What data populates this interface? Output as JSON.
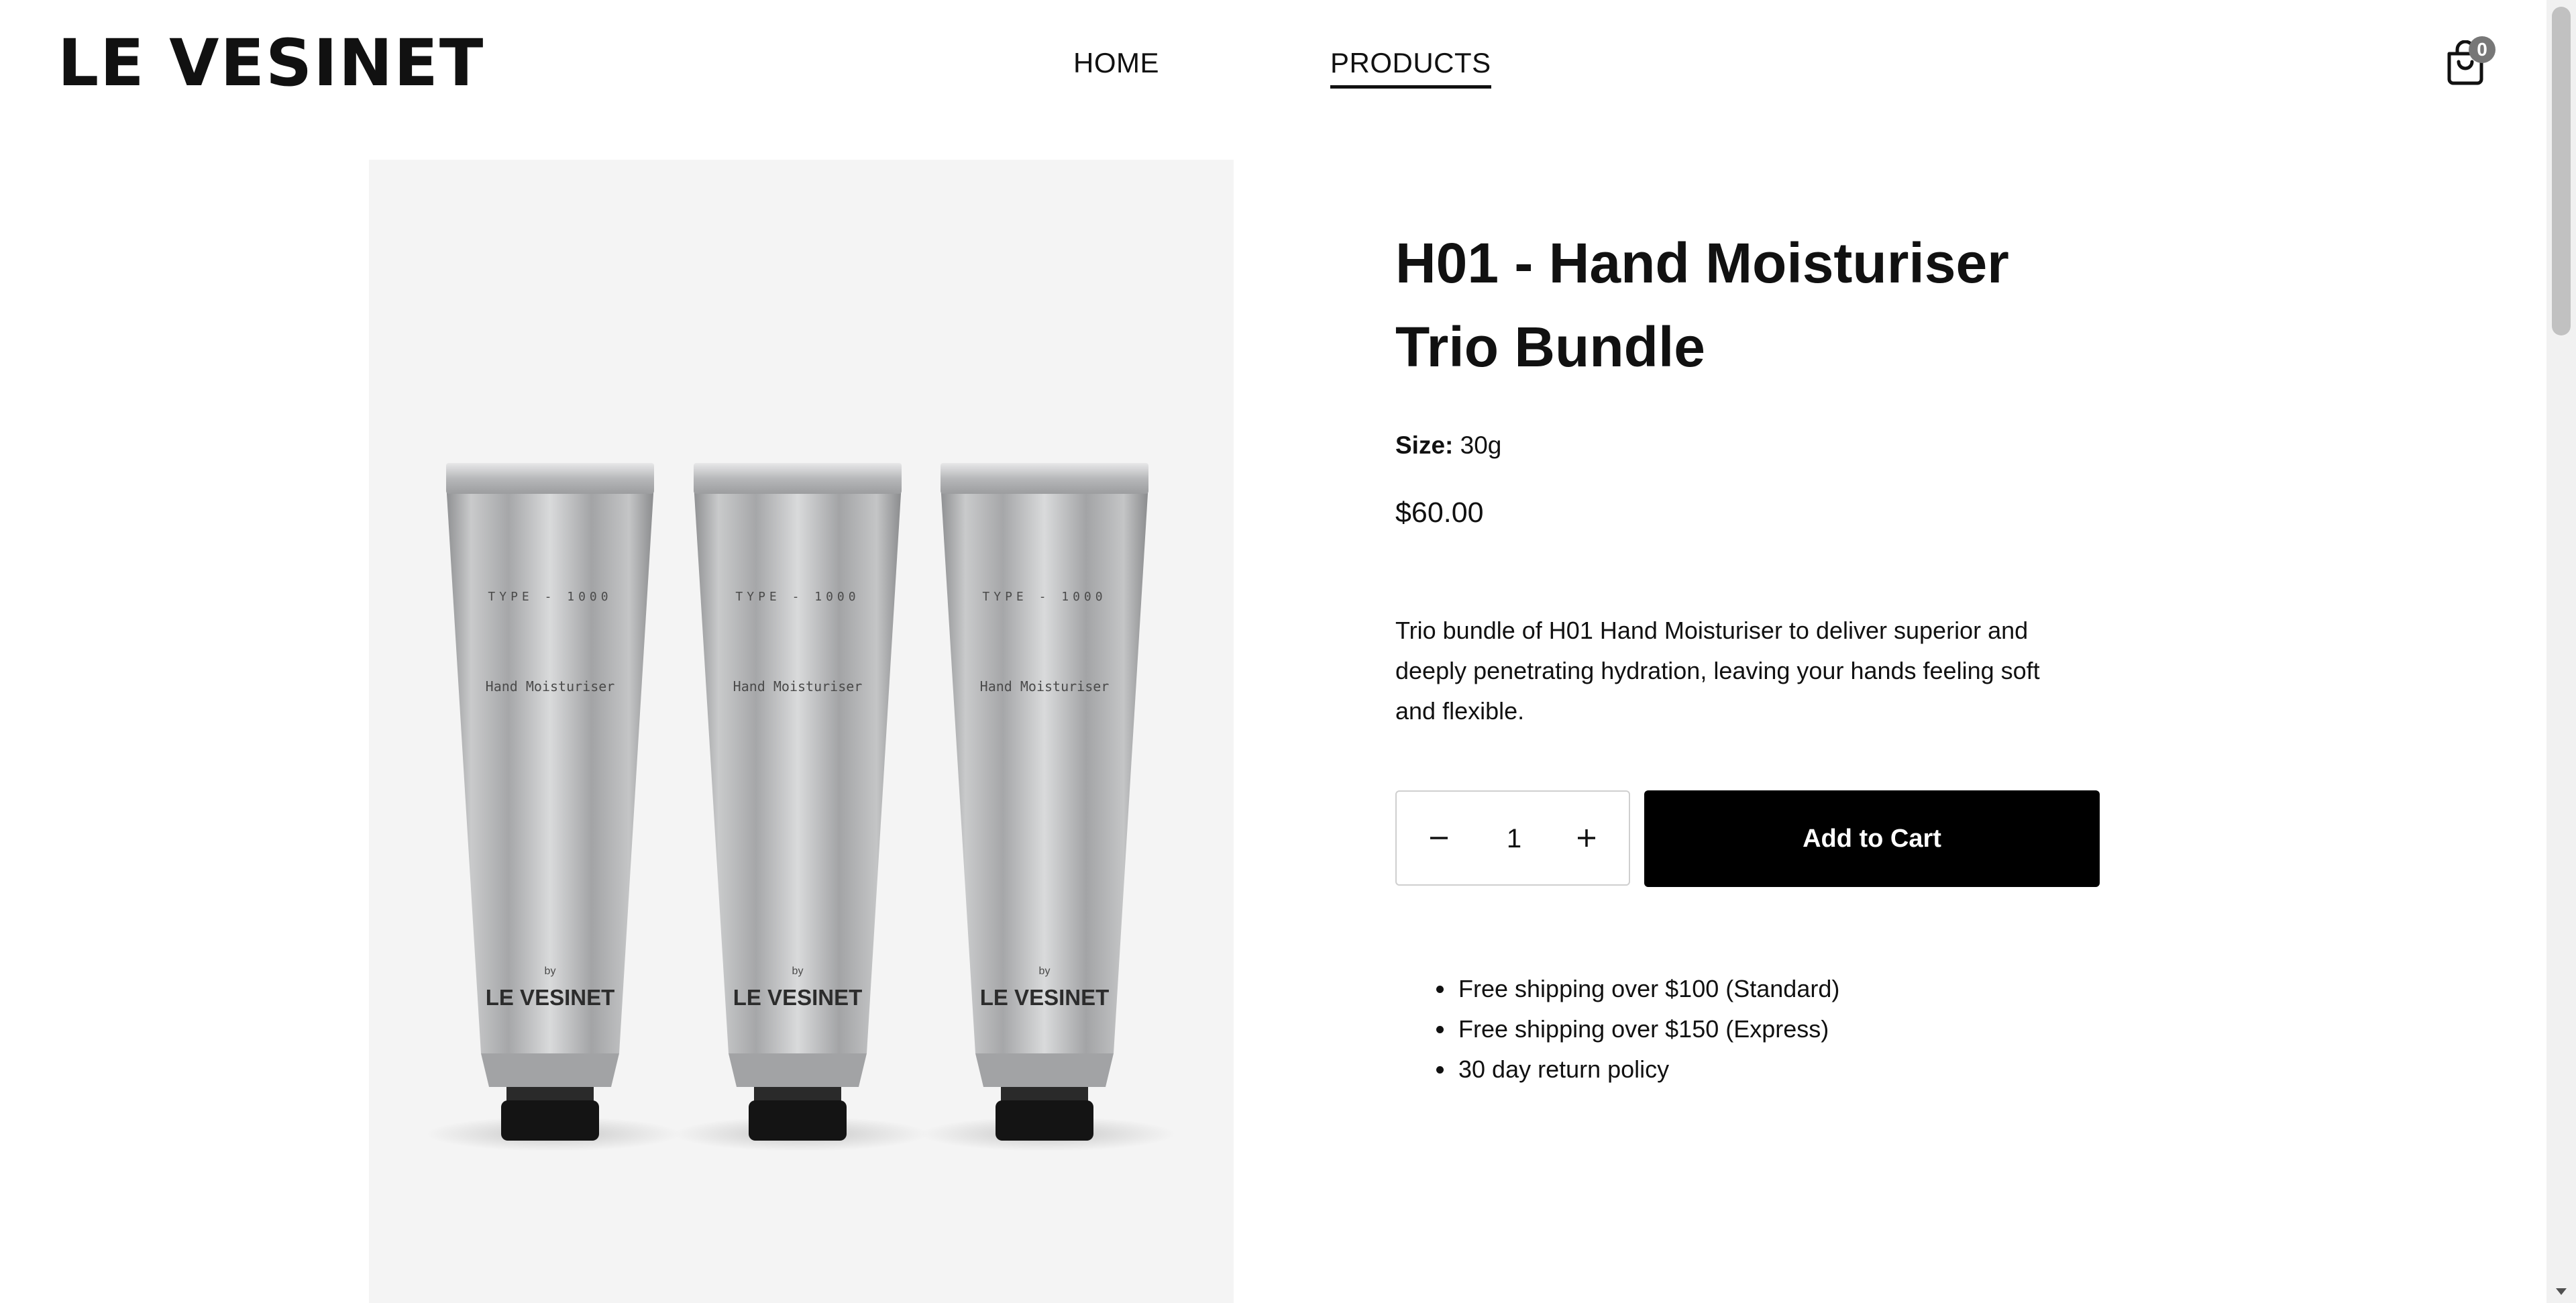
{
  "header": {
    "logo": "LE VESINET",
    "nav": [
      {
        "label": "HOME"
      },
      {
        "label": "PRODUCTS",
        "active": true
      }
    ],
    "cart": {
      "icon": "shopping-bag-icon",
      "count": "0"
    }
  },
  "product": {
    "image_alt": "Three aluminium tubes of H01 Hand Moisturiser",
    "tube": {
      "type": "TYPE - 1000",
      "name": "Hand Moisturiser",
      "by": "by",
      "brand": "LE VESINET"
    },
    "title_line1": "H01 - Hand Moisturiser",
    "title_line2": "Trio Bundle",
    "size_label": "Size:",
    "size_value": "30g",
    "price": "$60.00",
    "description": "Trio bundle of H01 Hand Moisturiser to deliver superior and deeply penetrating hydration, leaving your hands feeling soft and flexible.",
    "quantity": "1",
    "add_to_cart_label": "Add to Cart",
    "perks": [
      "Free shipping over $100 (Standard)",
      "Free shipping over $150 (Express)",
      "30 day return policy"
    ]
  },
  "colors": {
    "text": "#111111",
    "button": "#000000",
    "image_bg": "#f4f4f4",
    "badge": "#777777"
  }
}
